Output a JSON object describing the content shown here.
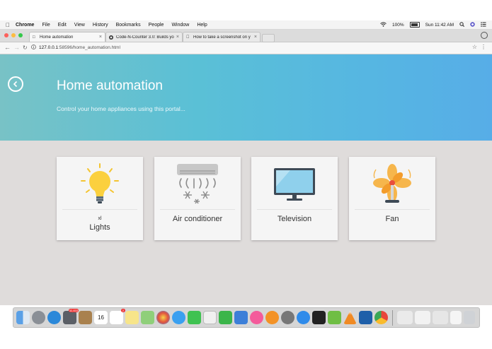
{
  "menubar": {
    "app": "Chrome",
    "items": [
      "File",
      "Edit",
      "View",
      "History",
      "Bookmarks",
      "People",
      "Window",
      "Help"
    ],
    "battery": "100%",
    "clock": "Sun 11:42 AM"
  },
  "tabs": [
    {
      "title": "Home automation",
      "active": true
    },
    {
      "title": "Code-N-Counter 3.0: Builds yo",
      "active": false
    },
    {
      "title": "How to take a screenshot on y",
      "active": false
    }
  ],
  "address": {
    "host": "127.0.0.1",
    "path": ":58596/home_automation.html"
  },
  "hero": {
    "title": "Home automation",
    "subtitle": "Control your home appliances using this portal..."
  },
  "cards": [
    {
      "name": "Lights",
      "count": "xl"
    },
    {
      "name": "Air conditioner"
    },
    {
      "name": "Television"
    },
    {
      "name": "Fan"
    }
  ],
  "colors": {
    "hero_start": "#78c2c6",
    "hero_end": "#57ade7",
    "content_bg": "#dfdcdb",
    "card_bg": "#f5f5f5"
  },
  "dock": {
    "icons": [
      "finder-icon",
      "launchpad-icon",
      "safari-icon",
      "photo-booth-icon",
      "notes-book-icon",
      "calendar-icon",
      "reminders-icon",
      "stickies-icon",
      "maps-icon",
      "photos-icon",
      "messages-icon",
      "facetime-icon",
      "preview-icon",
      "numbers-icon",
      "keynote-icon",
      "itunes-icon",
      "ibooks-icon",
      "system-preferences-icon",
      "app-store-icon",
      "terminal-icon",
      "upwork-icon",
      "vlc-icon",
      "sourcetree-icon",
      "chrome-icon"
    ],
    "badges": {
      "photo-booth-icon": "32,833",
      "reminders-icon": "2"
    },
    "calendar_day": "16"
  }
}
